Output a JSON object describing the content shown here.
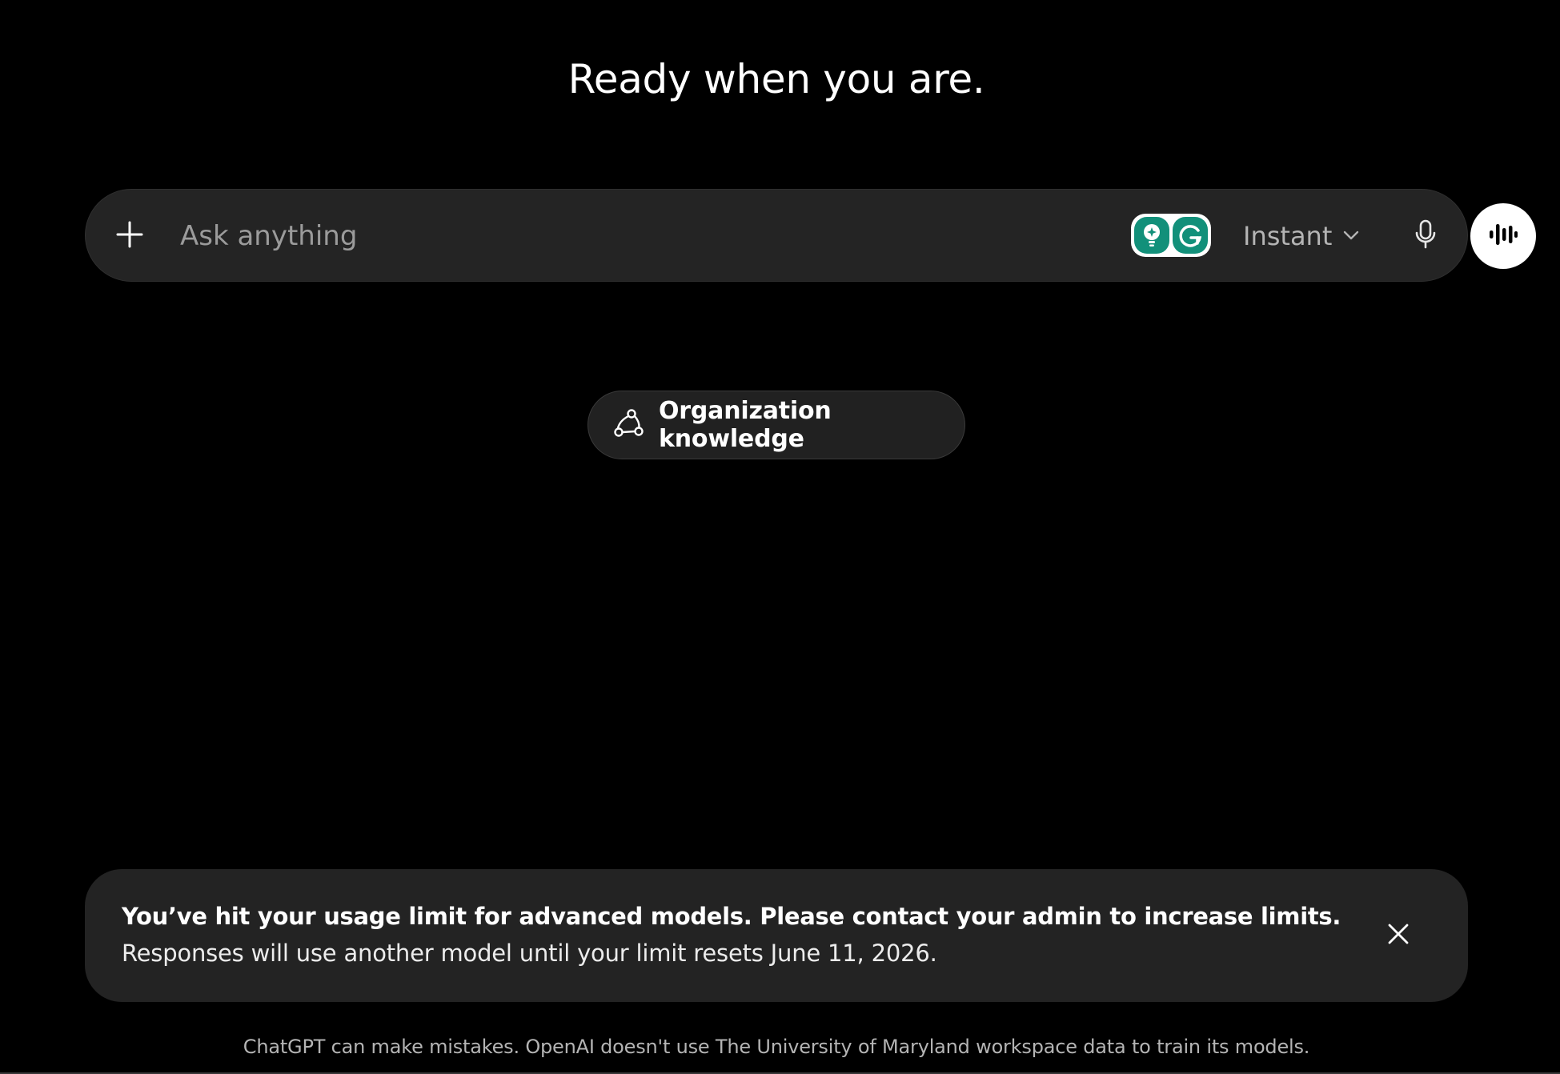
{
  "heading": "Ready when you are.",
  "composer": {
    "placeholder": "Ask anything",
    "model_label": "Instant"
  },
  "suggestion": {
    "label": "Organization knowledge"
  },
  "limit_banner": {
    "title": "You’ve hit your usage limit for advanced models. Please contact your admin to increase limits.",
    "subtitle": "Responses will use another model until your limit resets June 11, 2026."
  },
  "footer": "ChatGPT can make mistakes. OpenAI doesn't use The University of Maryland workspace data to train its models.",
  "icons": {
    "attach": "plus-icon",
    "grammarly_assist": "lightbulb-icon",
    "grammarly": "grammarly-g-icon",
    "model_dropdown": "chevron-down-icon",
    "dictate": "microphone-icon",
    "voice_mode": "waveform-icon",
    "org_knowledge": "connected-nodes-icon",
    "dismiss": "close-icon"
  },
  "colors": {
    "background": "#000000",
    "surface": "#242424",
    "grammarly_green": "#12907a",
    "muted_text": "#9b9b9b"
  }
}
